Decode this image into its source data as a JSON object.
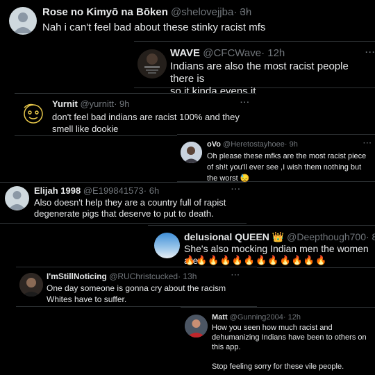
{
  "tweets": [
    {
      "name": "Rose no Kimyō na Bōken",
      "handle": "@shelovejjba",
      "time": "· 3h",
      "text": "Nah i can't feel bad about these stinky racist mfs",
      "avatar": "default-avatar"
    },
    {
      "name": "WAVE",
      "handle": "@CFCWave",
      "time": "· 12h",
      "text": "Indians are also the most racist people there is\nso it kinda evens it",
      "avatar": "photo-avatar"
    },
    {
      "name": "Yurnit",
      "handle": "@yurnitt",
      "time": "· 9h",
      "text": "don't feel bad indians are racist 100% and they\nsmell like dookie",
      "avatar": "doodle-avatar"
    },
    {
      "name": "oVo",
      "handle": "@Heretostayhoee",
      "time": "· 9h",
      "text": "Oh please these mfks are the most racist piece\nof sh!t you'll ever see ,I wish them nothing but\nthe worst",
      "emoji": "😓",
      "avatar": "photo-avatar"
    },
    {
      "name": "Elijah 1998",
      "handle": "@E199841573",
      "time": "· 6h",
      "text": "Also doesn't help they are a country full of rapist\ndegenerate pigs that deserve to put to death.",
      "avatar": "default-avatar"
    },
    {
      "name": "delusional QUEEN",
      "badge": "👑",
      "handle": "@Deepthough700",
      "time": "· 8h",
      "text": "She's also mocking Indian men the women are",
      "emoji_row": "🔥🔥🔥🔥🔥🔥🔥🔥🔥🔥🔥🔥",
      "avatar": "sky-avatar"
    },
    {
      "name": "I'mStillNoticing",
      "handle": "@RUChristcucked",
      "time": "· 13h",
      "text": "One day someone is gonna cry about the racism\nWhites have to suffer.",
      "avatar": "photo-avatar"
    },
    {
      "name": "Matt",
      "handle": "@Gunning2004",
      "time": "· 12h",
      "text": "How you seen how much racist and\ndehumanizing Indians have been to others on\nthis app.\n\nStop feeling sorry for these vile people.",
      "avatar": "photo-avatar"
    }
  ],
  "more_label": "···",
  "colors": {
    "background": "#000000",
    "text": "#e7e9ea",
    "secondary": "#71767b",
    "border": "#2f3336"
  }
}
